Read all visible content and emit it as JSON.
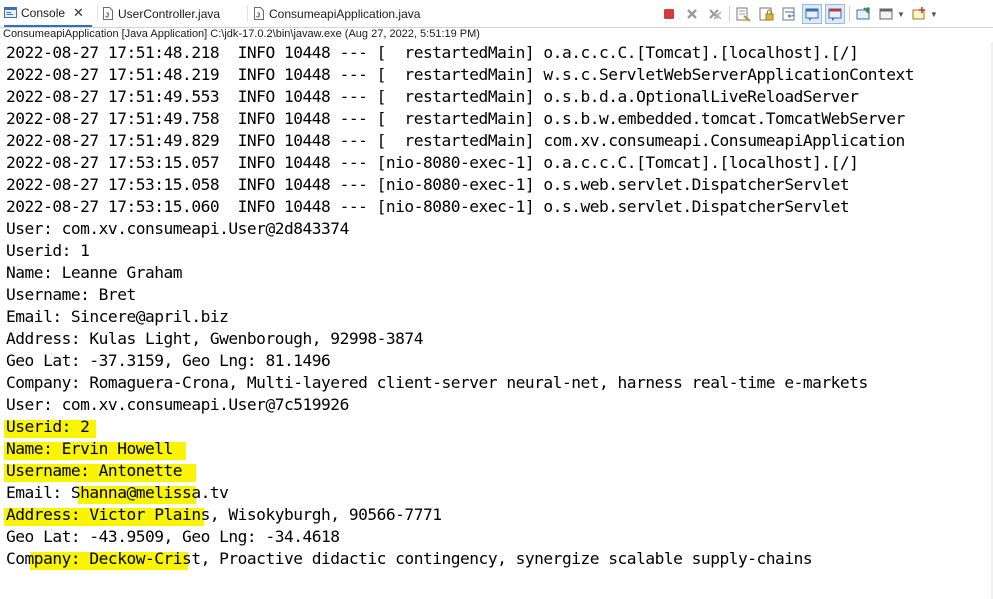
{
  "tabs": [
    {
      "label": "Console",
      "icon": "console-icon",
      "active": true,
      "close": "✕"
    },
    {
      "label": "UserController.java",
      "icon": "java-file-icon",
      "active": false
    },
    {
      "label": "ConsumeapiApplication.java",
      "icon": "java-file-icon",
      "active": false
    }
  ],
  "toolbar_icons": [
    "terminate-icon",
    "remove-launch-icon",
    "remove-all-terminated-icon",
    "clear-console-icon",
    "scroll-lock-icon",
    "word-wrap-icon",
    "show-on-stdout-icon",
    "show-on-stderr-icon",
    "pin-console-icon",
    "display-selected-console-icon",
    "open-console-icon"
  ],
  "launch_info": "ConsumeapiApplication [Java Application] C:\\jdk-17.0.2\\bin\\javaw.exe  (Aug 27, 2022, 5:51:19 PM)",
  "colors": {
    "accent": "#2c70c9",
    "highlight": "#f9f500",
    "terminate_red": "#d33a3a"
  },
  "console_lines": [
    "2022-08-27 17:51:48.218  INFO 10448 --- [  restartedMain] o.a.c.c.C.[Tomcat].[localhost].[/]",
    "2022-08-27 17:51:48.219  INFO 10448 --- [  restartedMain] w.s.c.ServletWebServerApplicationContext",
    "2022-08-27 17:51:49.553  INFO 10448 --- [  restartedMain] o.s.b.d.a.OptionalLiveReloadServer",
    "2022-08-27 17:51:49.758  INFO 10448 --- [  restartedMain] o.s.b.w.embedded.tomcat.TomcatWebServer",
    "2022-08-27 17:51:49.829  INFO 10448 --- [  restartedMain] com.xv.consumeapi.ConsumeapiApplication",
    "2022-08-27 17:53:15.057  INFO 10448 --- [nio-8080-exec-1] o.a.c.c.C.[Tomcat].[localhost].[/]",
    "2022-08-27 17:53:15.058  INFO 10448 --- [nio-8080-exec-1] o.s.web.servlet.DispatcherServlet",
    "2022-08-27 17:53:15.060  INFO 10448 --- [nio-8080-exec-1] o.s.web.servlet.DispatcherServlet",
    "User: com.xv.consumeapi.User@2d843374",
    "Userid: 1",
    "Name: Leanne Graham",
    "Username: Bret",
    "Email: Sincere@april.biz",
    "Address: Kulas Light, Gwenborough, 92998-3874",
    "Geo Lat: -37.3159, Geo Lng: 81.1496",
    "Company: Romaguera-Crona, Multi-layered client-server neural-net, harness real-time e-markets",
    "User: com.xv.consumeapi.User@7c519926",
    "Userid: 2",
    "Name: Ervin Howell",
    "Username: Antonette",
    "Email: Shanna@melissa.tv",
    "Address: Victor Plains, Wisokyburgh, 90566-7771",
    "Geo Lat: -43.9509, Geo Lng: -34.4618",
    "Company: Deckow-Crist, Proactive didactic contingency, synergize scalable supply-chains"
  ]
}
